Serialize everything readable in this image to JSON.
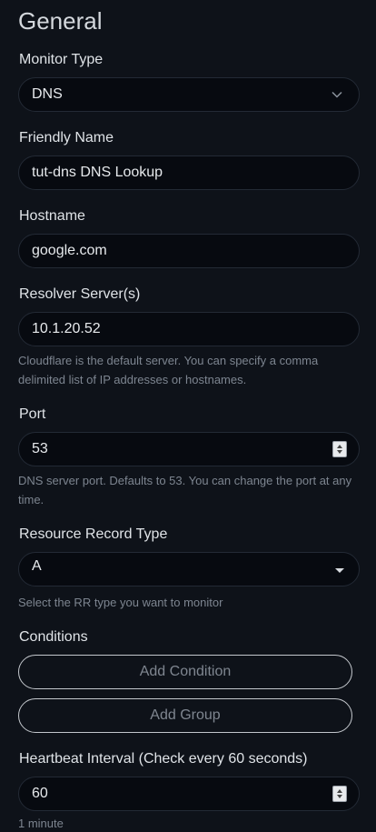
{
  "section_title": "General",
  "monitor_type": {
    "label": "Monitor Type",
    "value": "DNS"
  },
  "friendly_name": {
    "label": "Friendly Name",
    "value": "tut-dns DNS Lookup"
  },
  "hostname": {
    "label": "Hostname",
    "value": "google.com"
  },
  "resolver": {
    "label": "Resolver Server(s)",
    "value": "10.1.20.52",
    "help": "Cloudflare is the default server. You can specify a comma delimited list of IP addresses or hostnames."
  },
  "port": {
    "label": "Port",
    "value": "53",
    "help": "DNS server port. Defaults to 53. You can change the port at any time."
  },
  "rr_type": {
    "label": "Resource Record Type",
    "value": "A",
    "help": "Select the RR type you want to monitor"
  },
  "conditions": {
    "label": "Conditions",
    "add_condition": "Add Condition",
    "add_group": "Add Group"
  },
  "heartbeat": {
    "label": "Heartbeat Interval (Check every 60 seconds)",
    "value": "60",
    "help": "1 minute"
  },
  "icons": {
    "select_chevron": "chevron-down-icon",
    "number_spinner": "spinner-arrows-icon",
    "dropdown_caret": "caret-down-icon"
  }
}
